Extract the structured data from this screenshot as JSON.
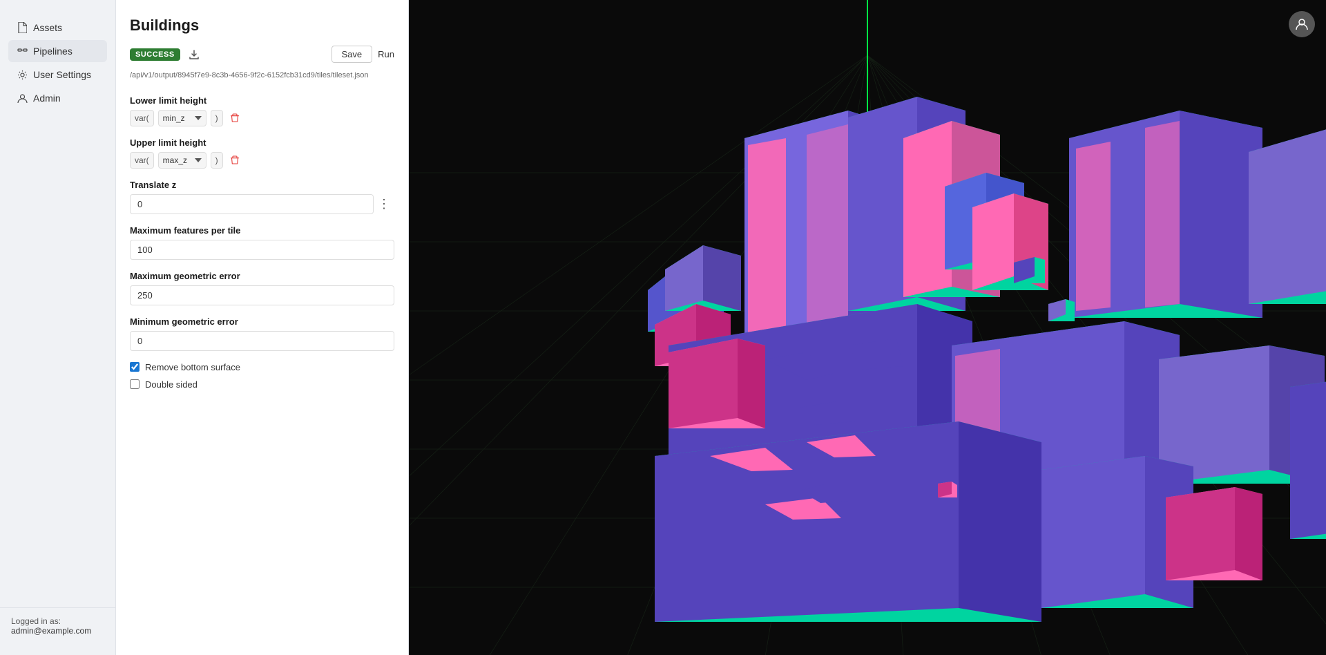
{
  "sidebar": {
    "items": [
      {
        "id": "assets",
        "label": "Assets",
        "icon": "file-icon"
      },
      {
        "id": "pipelines",
        "label": "Pipelines",
        "icon": "pipeline-icon",
        "active": true
      },
      {
        "id": "user-settings",
        "label": "User Settings",
        "icon": "gear-icon"
      },
      {
        "id": "admin",
        "label": "Admin",
        "icon": "admin-icon"
      }
    ],
    "footer": {
      "logged_in_text": "Logged in as:",
      "user_email": "admin@example.com"
    }
  },
  "panel": {
    "title": "Buildings",
    "status": "SUCCESS",
    "api_path": "/api/v1/output/8945f7e9-8c3b-4656-9f2c-6152fcb31cd9/tiles/tileset.json",
    "save_label": "Save",
    "run_label": "Run",
    "fields": {
      "lower_limit_height": {
        "label": "Lower limit height",
        "var_prefix": "var(",
        "var_value": "min_z",
        "var_suffix": ")"
      },
      "upper_limit_height": {
        "label": "Upper limit height",
        "var_prefix": "var(",
        "var_value": "max_z",
        "var_suffix": ")"
      },
      "translate_z": {
        "label": "Translate z",
        "value": "0"
      },
      "max_features_per_tile": {
        "label": "Maximum features per tile",
        "value": "100"
      },
      "max_geometric_error": {
        "label": "Maximum geometric error",
        "value": "250"
      },
      "min_geometric_error": {
        "label": "Minimum geometric error",
        "value": "0"
      }
    },
    "checkboxes": {
      "remove_bottom_surface": {
        "label": "Remove bottom surface",
        "checked": true
      },
      "double_sided": {
        "label": "Double sided",
        "checked": false
      }
    }
  }
}
